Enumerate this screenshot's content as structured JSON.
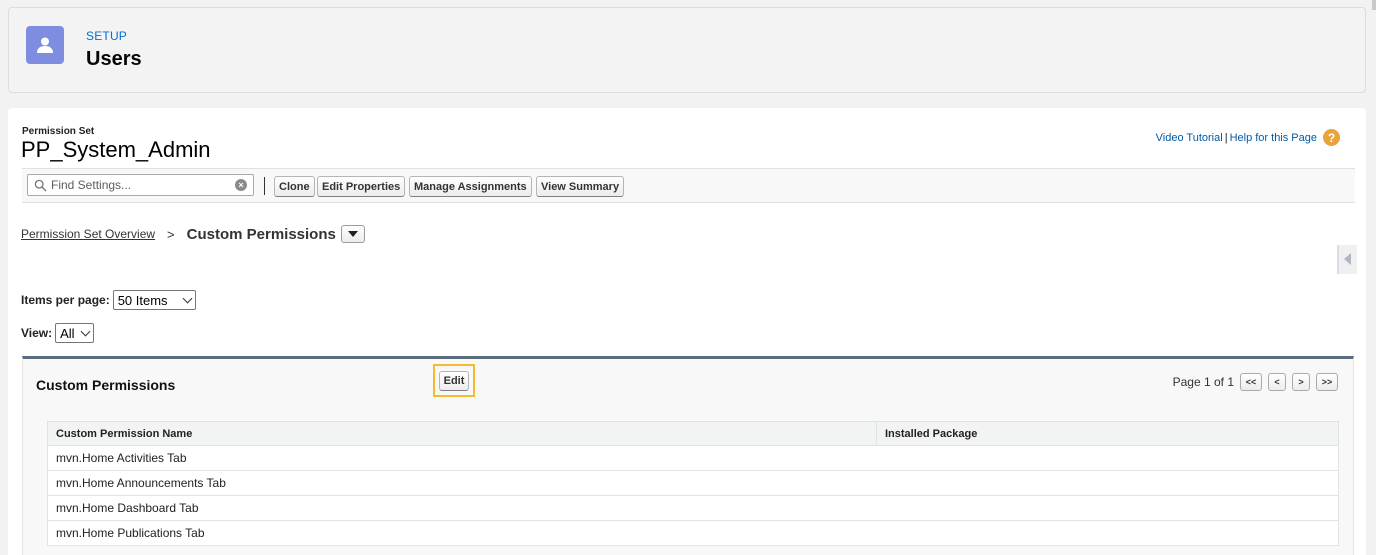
{
  "setup": {
    "eyebrow": "SETUP",
    "title": "Users",
    "icon": "user-icon"
  },
  "permission_set": {
    "label": "Permission Set",
    "name": "PP_System_Admin"
  },
  "help": {
    "video_tutorial": "Video Tutorial",
    "separator": "|",
    "help_page": "Help for this Page"
  },
  "toolbar": {
    "search_placeholder": "Find Settings...",
    "buttons": [
      "Clone",
      "Edit Properties",
      "Manage Assignments",
      "View Summary"
    ]
  },
  "breadcrumb": {
    "link": "Permission Set Overview",
    "separator": ">",
    "current": "Custom Permissions"
  },
  "items_per_page": {
    "label": "Items per page:",
    "value": "50 Items"
  },
  "view": {
    "label": "View:",
    "value": "All"
  },
  "custom_permissions": {
    "title": "Custom Permissions",
    "edit_label": "Edit",
    "pager_text": "Page 1 of 1",
    "pager_buttons": [
      "<<",
      "<",
      ">",
      ">>"
    ],
    "columns": [
      "Custom Permission Name",
      "Installed Package"
    ],
    "rows": [
      [
        "mvn.Home Activities Tab",
        ""
      ],
      [
        "mvn.Home Announcements Tab",
        ""
      ],
      [
        "mvn.Home Dashboard Tab",
        ""
      ],
      [
        "mvn.Home Publications Tab",
        ""
      ]
    ]
  },
  "colors": {
    "link": "#0070d2",
    "icon_bg": "#7f8de1",
    "highlight": "#f2bb30",
    "help_icon": "#e8a33d"
  }
}
